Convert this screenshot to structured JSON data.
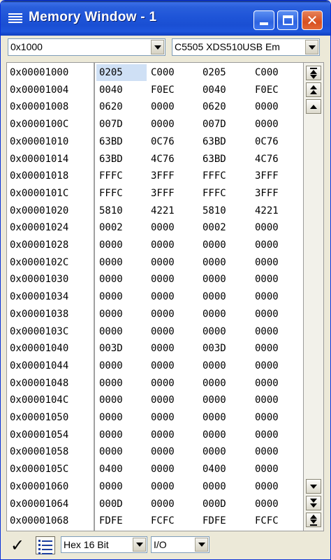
{
  "window": {
    "title": "Memory Window - 1"
  },
  "toolbar": {
    "address_value": "0x1000",
    "target_value": "C5505 XDS510USB Em"
  },
  "bottom": {
    "format_value": "Hex 16 Bit",
    "page_value": "I/O"
  },
  "memory": {
    "rows": [
      {
        "addr": "0x00001000",
        "v": [
          "0205",
          "C000",
          "0205",
          "C000"
        ]
      },
      {
        "addr": "0x00001004",
        "v": [
          "0040",
          "F0EC",
          "0040",
          "F0EC"
        ]
      },
      {
        "addr": "0x00001008",
        "v": [
          "0620",
          "0000",
          "0620",
          "0000"
        ]
      },
      {
        "addr": "0x0000100C",
        "v": [
          "007D",
          "0000",
          "007D",
          "0000"
        ]
      },
      {
        "addr": "0x00001010",
        "v": [
          "63BD",
          "0C76",
          "63BD",
          "0C76"
        ]
      },
      {
        "addr": "0x00001014",
        "v": [
          "63BD",
          "4C76",
          "63BD",
          "4C76"
        ]
      },
      {
        "addr": "0x00001018",
        "v": [
          "FFFC",
          "3FFF",
          "FFFC",
          "3FFF"
        ]
      },
      {
        "addr": "0x0000101C",
        "v": [
          "FFFC",
          "3FFF",
          "FFFC",
          "3FFF"
        ]
      },
      {
        "addr": "0x00001020",
        "v": [
          "5810",
          "4221",
          "5810",
          "4221"
        ]
      },
      {
        "addr": "0x00001024",
        "v": [
          "0002",
          "0000",
          "0002",
          "0000"
        ]
      },
      {
        "addr": "0x00001028",
        "v": [
          "0000",
          "0000",
          "0000",
          "0000"
        ]
      },
      {
        "addr": "0x0000102C",
        "v": [
          "0000",
          "0000",
          "0000",
          "0000"
        ]
      },
      {
        "addr": "0x00001030",
        "v": [
          "0000",
          "0000",
          "0000",
          "0000"
        ]
      },
      {
        "addr": "0x00001034",
        "v": [
          "0000",
          "0000",
          "0000",
          "0000"
        ]
      },
      {
        "addr": "0x00001038",
        "v": [
          "0000",
          "0000",
          "0000",
          "0000"
        ]
      },
      {
        "addr": "0x0000103C",
        "v": [
          "0000",
          "0000",
          "0000",
          "0000"
        ]
      },
      {
        "addr": "0x00001040",
        "v": [
          "003D",
          "0000",
          "003D",
          "0000"
        ]
      },
      {
        "addr": "0x00001044",
        "v": [
          "0000",
          "0000",
          "0000",
          "0000"
        ]
      },
      {
        "addr": "0x00001048",
        "v": [
          "0000",
          "0000",
          "0000",
          "0000"
        ]
      },
      {
        "addr": "0x0000104C",
        "v": [
          "0000",
          "0000",
          "0000",
          "0000"
        ]
      },
      {
        "addr": "0x00001050",
        "v": [
          "0000",
          "0000",
          "0000",
          "0000"
        ]
      },
      {
        "addr": "0x00001054",
        "v": [
          "0000",
          "0000",
          "0000",
          "0000"
        ]
      },
      {
        "addr": "0x00001058",
        "v": [
          "0000",
          "0000",
          "0000",
          "0000"
        ]
      },
      {
        "addr": "0x0000105C",
        "v": [
          "0400",
          "0000",
          "0400",
          "0000"
        ]
      },
      {
        "addr": "0x00001060",
        "v": [
          "0000",
          "0000",
          "0000",
          "0000"
        ]
      },
      {
        "addr": "0x00001064",
        "v": [
          "000D",
          "0000",
          "000D",
          "0000"
        ]
      },
      {
        "addr": "0x00001068",
        "v": [
          "FDFE",
          "FCFC",
          "FDFE",
          "FCFC"
        ]
      }
    ]
  }
}
